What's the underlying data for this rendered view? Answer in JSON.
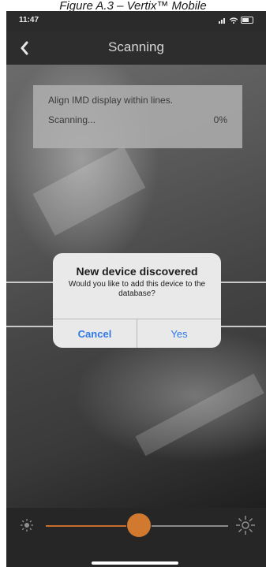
{
  "caption": "Figure A.3 – Vertix™ Mobile",
  "status_bar": {
    "time": "11:47"
  },
  "nav": {
    "back_icon": "chevron-left-icon",
    "title": "Scanning"
  },
  "scan_box": {
    "instruction": "Align IMD display within lines.",
    "status": "Scanning...",
    "progress": "0%"
  },
  "dialog": {
    "title": "New device discovered",
    "message": "Would you like to add this device to the database?",
    "cancel_label": "Cancel",
    "yes_label": "Yes"
  },
  "brightness": {
    "min_icon": "sun-small-icon",
    "max_icon": "sun-large-icon",
    "level": 0.51
  },
  "colors": {
    "accent": "#d0792f",
    "dialog_button": "#2f7be6",
    "background": "#2a2a2a"
  }
}
